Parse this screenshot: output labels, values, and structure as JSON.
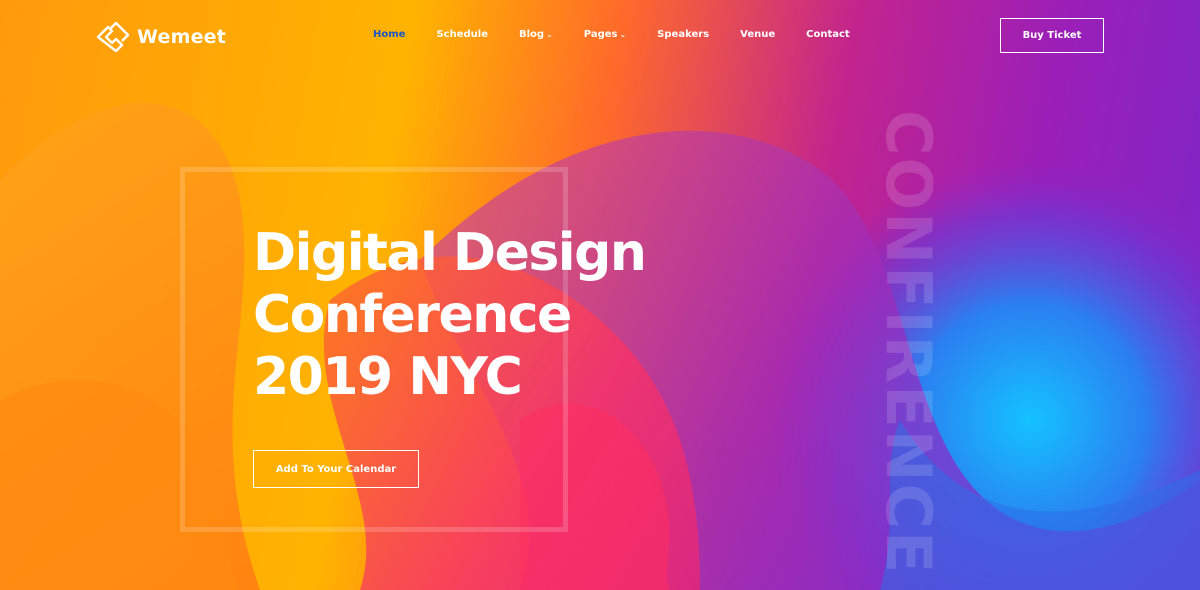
{
  "brand": {
    "name": "Wemeet"
  },
  "nav": {
    "items": [
      {
        "label": "Home",
        "active": true
      },
      {
        "label": "Schedule"
      },
      {
        "label": "Blog",
        "has_dropdown": true
      },
      {
        "label": "Pages",
        "has_dropdown": true
      },
      {
        "label": "Speakers"
      },
      {
        "label": "Venue"
      },
      {
        "label": "Contact"
      }
    ],
    "buy_button": "Buy Ticket"
  },
  "hero": {
    "headline_lines": [
      "Digital Design",
      "Conference",
      "2019 NYC"
    ],
    "cta_label": "Add To Your Calendar",
    "vertical_word": "CONFIRENCE"
  },
  "icons": {
    "logo": "diamond-arrow-logo-icon",
    "caret": "chevron-down-icon"
  },
  "colors": {
    "active_nav": "#1a56c8",
    "orange": "#ff9a0c",
    "yellow": "#ffb300",
    "pink": "#ff2a6a",
    "purple": "#9b1fb8",
    "blue": "#1ab8ff"
  }
}
